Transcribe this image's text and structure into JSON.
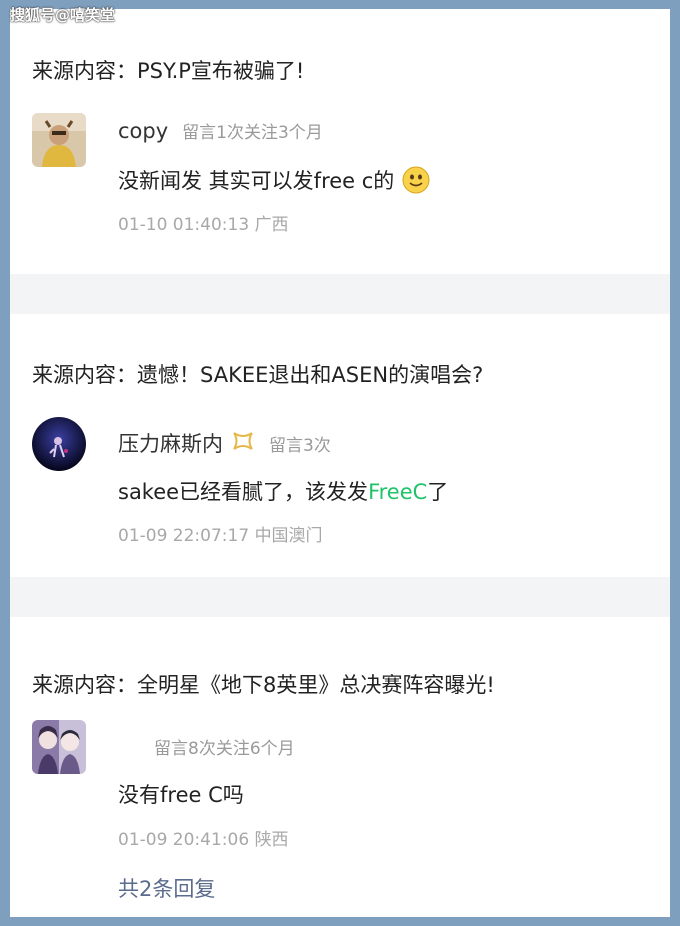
{
  "watermark": "搜狐号@嘻笑堂",
  "cards": [
    {
      "source": "来源内容：PSY.P宣布被骗了!",
      "user": "copy",
      "meta_comments": "留言1次",
      "meta_follow": "关注3个月",
      "comment": "没新闻发 其实可以发free c的",
      "emoji_icon": "smiley-emoji-icon",
      "time": "01-10 01:40:13",
      "location": "广西"
    },
    {
      "source": "来源内容：遗憾！SAKEE退出和ASEN的演唱会?",
      "user": "压力麻斯内",
      "badge_icon": "gold-ribbon-badge-icon",
      "meta_comments": "留言3次",
      "comment_prefix": "sakee已经看腻了，该发发",
      "comment_highlight": "FreeC",
      "comment_suffix": "了",
      "highlight_color": "#1fc36a",
      "time": "01-09 22:07:17",
      "location": "中国澳门"
    },
    {
      "source": "来源内容：全明星《地下8英里》总决赛阵容曝光!",
      "user": "",
      "meta_comments": "留言8次",
      "meta_follow": "关注6个月",
      "comment": "没有free C吗",
      "time": "01-09 20:41:06",
      "location": "陕西",
      "replies": "共2条回复"
    }
  ]
}
